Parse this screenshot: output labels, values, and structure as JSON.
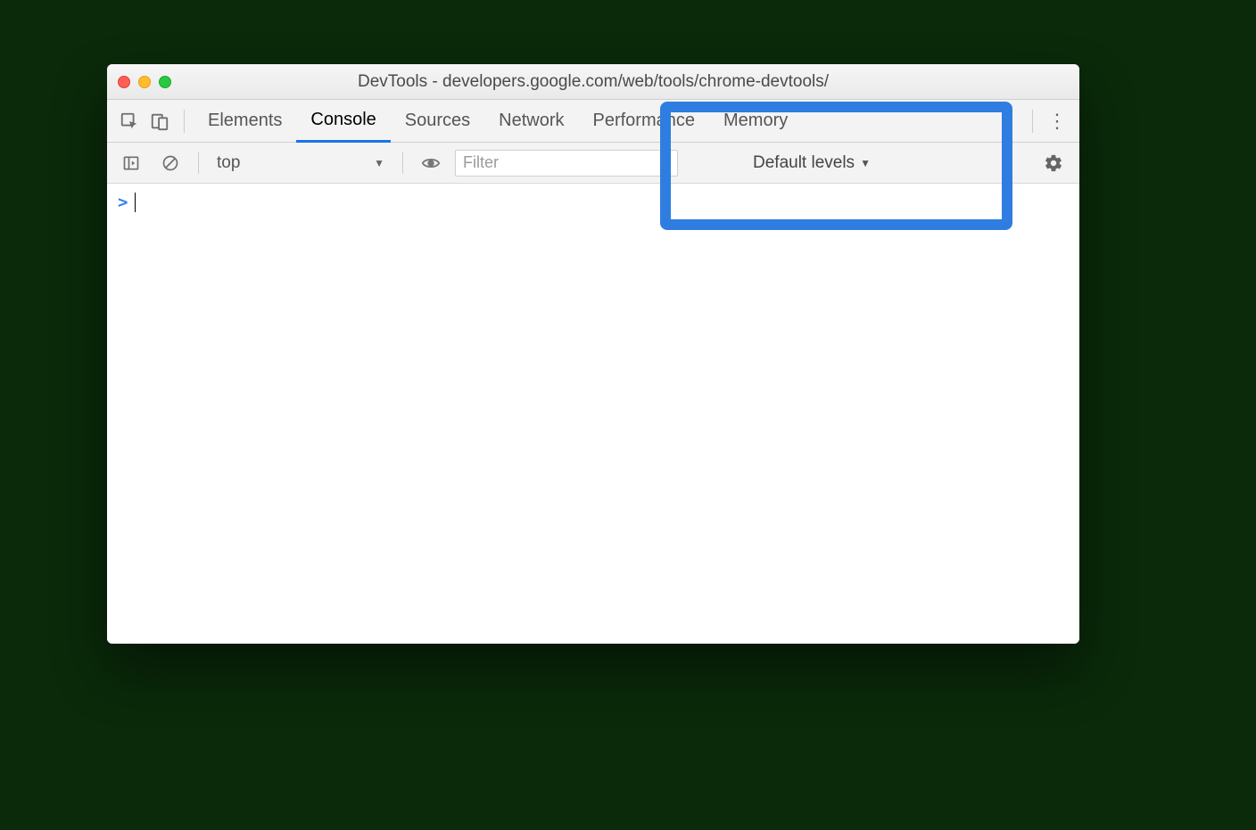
{
  "window": {
    "title": "DevTools - developers.google.com/web/tools/chrome-devtools/"
  },
  "tabs": {
    "elements": "Elements",
    "console": "Console",
    "sources": "Sources",
    "network": "Network",
    "performance": "Performance",
    "memory": "Memory"
  },
  "toolbar": {
    "context": "top",
    "filter_placeholder": "Filter",
    "levels": "Default levels"
  },
  "console": {
    "prompt": ">"
  }
}
